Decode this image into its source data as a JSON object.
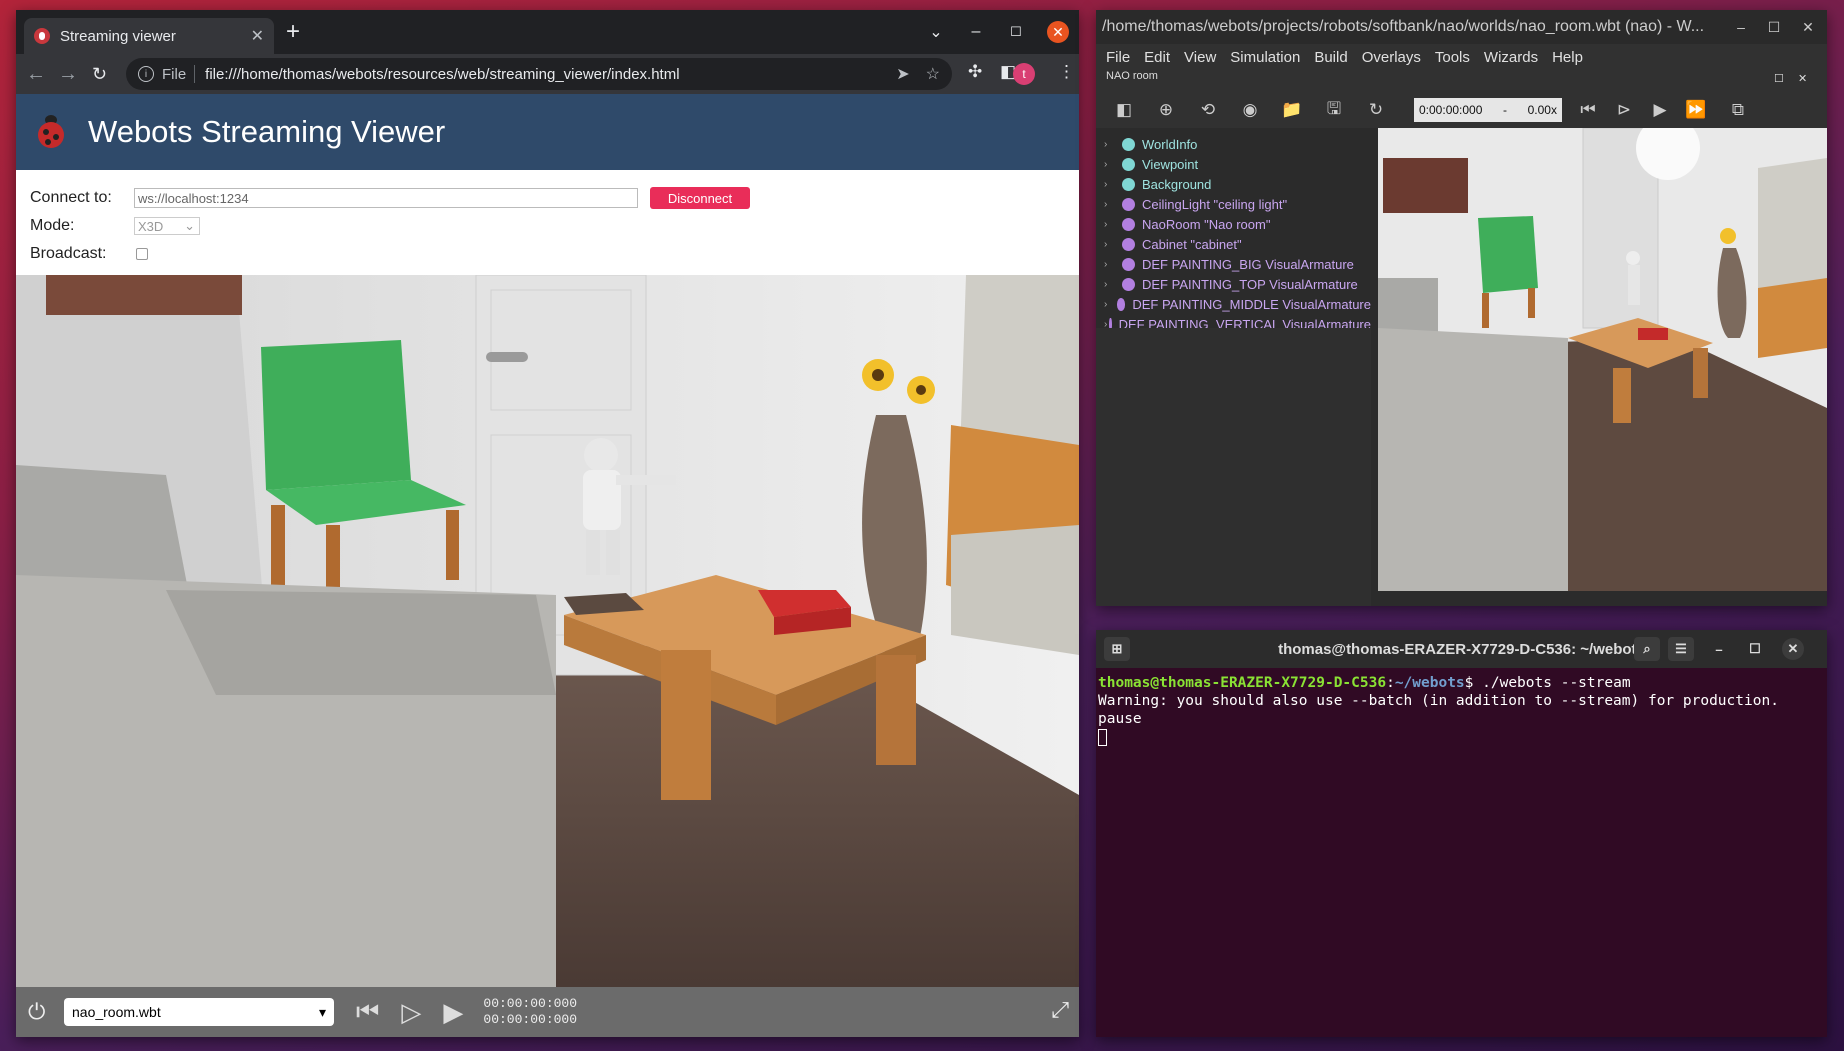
{
  "browser": {
    "tab_title": "Streaming viewer",
    "new_tab": "+",
    "url_scheme": "File",
    "url": "file:///home/thomas/webots/resources/web/streaming_viewer/index.html",
    "avatar_letter": "t"
  },
  "page": {
    "title": "Webots Streaming Viewer",
    "connect_label": "Connect to:",
    "connect_value": "ws://localhost:1234",
    "disconnect_label": "Disconnect",
    "mode_label": "Mode:",
    "mode_value": "X3D",
    "broadcast_label": "Broadcast:"
  },
  "player": {
    "world_file": "nao_room.wbt",
    "time_current": "00:00:00:000",
    "time_total": "00:00:00:000"
  },
  "webots": {
    "window_title": "/home/thomas/webots/projects/robots/softbank/nao/worlds/nao_room.wbt (nao) - W...",
    "menu": [
      "File",
      "Edit",
      "View",
      "Simulation",
      "Build",
      "Overlays",
      "Tools",
      "Wizards",
      "Help"
    ],
    "world_name": "NAO room",
    "sim_time": "0:00:00:000",
    "sim_sep": "-",
    "sim_speed": "0.00x",
    "scene_tree": [
      {
        "label": "WorldInfo",
        "color": "#7fd6d3"
      },
      {
        "label": "Viewpoint",
        "color": "#7fd6d3"
      },
      {
        "label": "Background",
        "color": "#7fd6d3"
      },
      {
        "label": "CeilingLight \"ceiling light\"",
        "color": "#b27fe0"
      },
      {
        "label": "NaoRoom \"Nao room\"",
        "color": "#b27fe0"
      },
      {
        "label": "Cabinet \"cabinet\"",
        "color": "#b27fe0"
      },
      {
        "label": "DEF PAINTING_BIG VisualArmature",
        "color": "#b27fe0"
      },
      {
        "label": "DEF PAINTING_TOP VisualArmature",
        "color": "#b27fe0"
      },
      {
        "label": "DEF PAINTING_MIDDLE VisualArmature",
        "color": "#b27fe0"
      },
      {
        "label": "DEF PAINTING_VERTICAL VisualArmature",
        "color": "#b27fe0"
      }
    ]
  },
  "terminal": {
    "title": "thomas@thomas-ERAZER-X7729-D-C536: ~/webots",
    "prompt_user": "thomas@thomas-ERAZER-X7729-D-C536",
    "prompt_colon": ":",
    "prompt_path": "~/webots",
    "prompt_dollar": "$ ",
    "command": "./webots --stream",
    "line2": "Warning: you should also use --batch (in addition to --stream) for production.",
    "line3": "pause"
  }
}
